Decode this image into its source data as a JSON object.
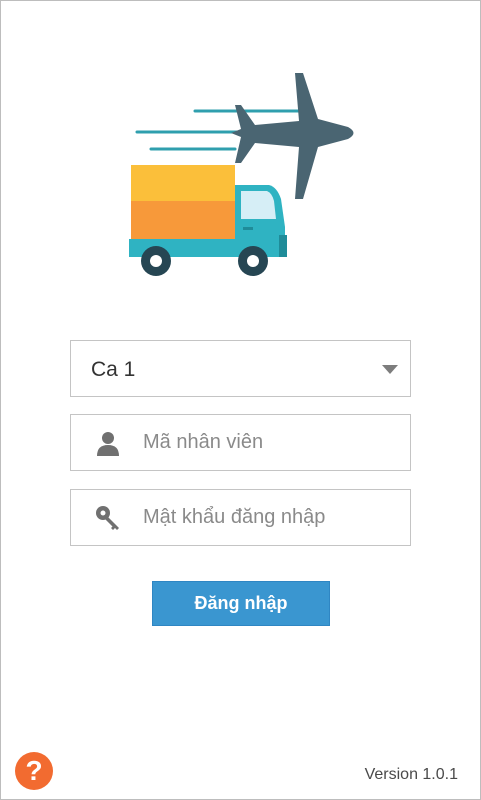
{
  "shift_select": {
    "selected": "Ca 1",
    "icon": "chevron-down-icon"
  },
  "employee_field": {
    "value": "",
    "placeholder": "Mã nhân viên",
    "icon": "user-icon"
  },
  "password_field": {
    "value": "",
    "placeholder": "Mật khẩu đăng nhập",
    "icon": "key-icon"
  },
  "login_button": {
    "label": "Đăng nhập"
  },
  "help": {
    "label": "?",
    "icon": "help-icon"
  },
  "version": "Version 1.0.1",
  "colors": {
    "accent": "#3a96d0",
    "help": "#f26b30",
    "truck_body": "#2fb3c2",
    "cargo_top": "#fbbf3a",
    "cargo_bottom": "#f7993a",
    "plane": "#4a6572"
  }
}
